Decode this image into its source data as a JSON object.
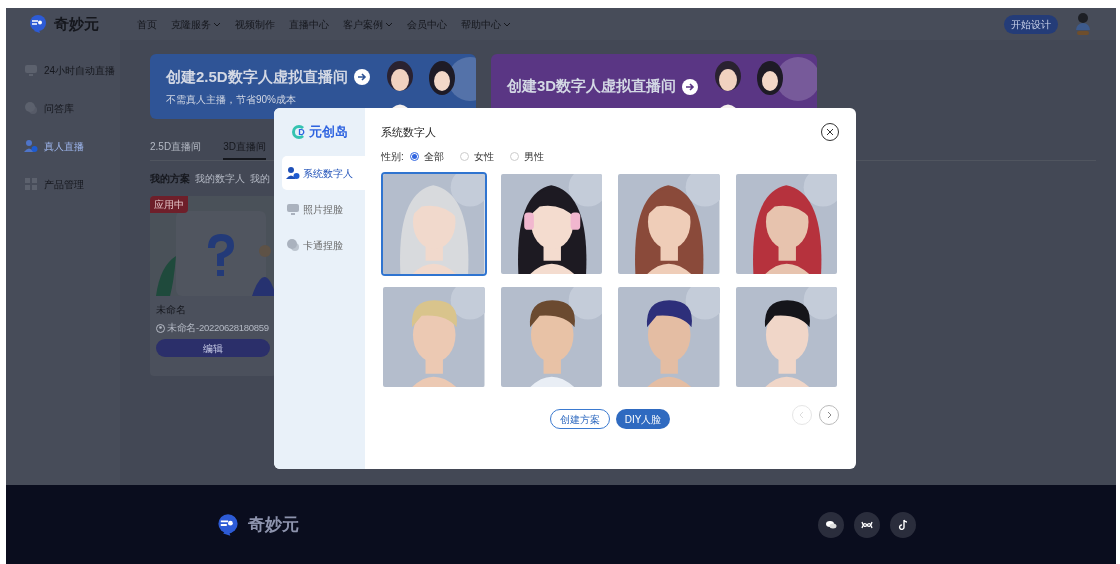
{
  "header": {
    "logo": "奇妙元",
    "nav": [
      {
        "label": "首页",
        "dropdown": false
      },
      {
        "label": "克隆服务",
        "dropdown": true
      },
      {
        "label": "视频制作",
        "dropdown": false
      },
      {
        "label": "直播中心",
        "dropdown": false
      },
      {
        "label": "客户案例",
        "dropdown": true
      },
      {
        "label": "会员中心",
        "dropdown": false
      },
      {
        "label": "帮助中心",
        "dropdown": true
      }
    ],
    "start_button": "开始设计"
  },
  "sidebar": {
    "items": [
      {
        "label": "24小时自动直播",
        "selected": false
      },
      {
        "label": "问答库",
        "selected": false
      },
      {
        "label": "真人直播",
        "selected": true
      },
      {
        "label": "产品管理",
        "selected": false
      }
    ]
  },
  "banners": [
    {
      "title": "创建2.5D数字人虚拟直播间",
      "subtitle": "不需真人主播，节省90%成本",
      "color": "#2f5496"
    },
    {
      "title": "创建3D数字人虚拟直播间",
      "color": "#5a3684"
    }
  ],
  "room_tabs": [
    {
      "label": "2.5D直播间",
      "selected": false
    },
    {
      "label": "3D直播间",
      "selected": true
    }
  ],
  "sub_tabs": [
    {
      "label": "我的方案",
      "selected": true
    },
    {
      "label": "我的数字人",
      "selected": false
    },
    {
      "label": "我的",
      "selected": false
    }
  ],
  "plan_card": {
    "badge": "应用中",
    "title": "未命名",
    "owner": "未命名-20220628180859",
    "edit_button": "编辑"
  },
  "dialog": {
    "brand_mark": "D",
    "brand": "元创岛",
    "menu": [
      {
        "label": "系统数字人",
        "selected": true
      },
      {
        "label": "照片捏脸",
        "selected": false
      },
      {
        "label": "卡通捏脸",
        "selected": false
      }
    ],
    "title": "系统数字人",
    "gender": {
      "label": "性别:",
      "options": [
        {
          "label": "全部",
          "selected": true
        },
        {
          "label": "女性",
          "selected": false
        },
        {
          "label": "男性",
          "selected": false
        }
      ]
    },
    "avatars": [
      {
        "kind": "picture",
        "selected": true
      },
      {
        "kind": "picture",
        "selected": false
      },
      {
        "kind": "picture",
        "selected": false
      },
      {
        "kind": "picture",
        "selected": false
      },
      {
        "kind": "picture",
        "selected": false
      },
      {
        "kind": "picture",
        "selected": false
      },
      {
        "kind": "picture",
        "selected": false
      },
      {
        "kind": "picture",
        "selected": false
      }
    ],
    "buttons": [
      {
        "label": "创建方案",
        "kind": "outline"
      },
      {
        "label": "DIY人脸",
        "kind": "primary"
      }
    ],
    "pager": [
      {
        "kind": "prev",
        "disabled": true
      },
      {
        "kind": "next",
        "disabled": false
      }
    ]
  },
  "footer": {
    "logo": "奇妙元"
  }
}
